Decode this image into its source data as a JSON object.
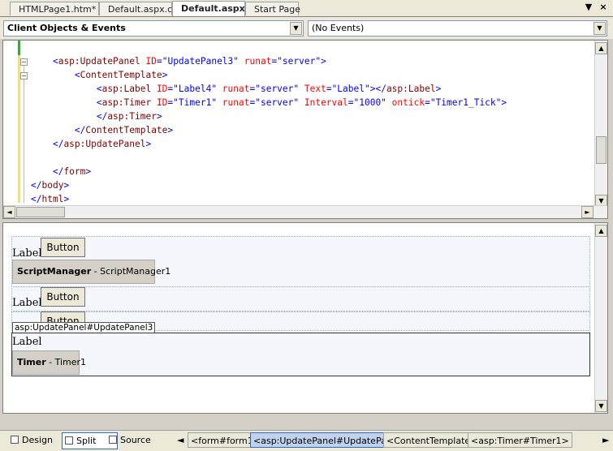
{
  "tabs": [
    {
      "label": "HTMLPage1.htm*"
    },
    {
      "label": "Default.aspx.cs"
    },
    {
      "label": "Default.aspx*"
    },
    {
      "label": "Start Page"
    }
  ],
  "tab_controls": {
    "dropdown": "▼",
    "close": "×"
  },
  "dropdowns": {
    "objects": "Client Objects & Events",
    "events": "(No Events)"
  },
  "code_lines": [
    {
      "indent": "    ",
      "tokens": [
        {
          "t": "<",
          "c": "b"
        },
        {
          "t": "asp:UpdatePanel",
          "c": "m"
        },
        {
          "t": " ID",
          "c": "r"
        },
        {
          "t": "=",
          "c": "b"
        },
        {
          "t": "\"UpdatePanel3\"",
          "c": "b"
        },
        {
          "t": " runat",
          "c": "r"
        },
        {
          "t": "=",
          "c": "b"
        },
        {
          "t": "\"server\"",
          "c": "b"
        },
        {
          "t": ">",
          "c": "b"
        }
      ]
    },
    {
      "indent": "        ",
      "tokens": [
        {
          "t": "<",
          "c": "b"
        },
        {
          "t": "ContentTemplate",
          "c": "m"
        },
        {
          "t": ">",
          "c": "b"
        }
      ]
    },
    {
      "indent": "            ",
      "tokens": [
        {
          "t": "<",
          "c": "b"
        },
        {
          "t": "asp:Label",
          "c": "m"
        },
        {
          "t": " ID",
          "c": "r"
        },
        {
          "t": "=",
          "c": "b"
        },
        {
          "t": "\"Label4\"",
          "c": "b"
        },
        {
          "t": " runat",
          "c": "r"
        },
        {
          "t": "=",
          "c": "b"
        },
        {
          "t": "\"server\"",
          "c": "b"
        },
        {
          "t": " Text",
          "c": "r"
        },
        {
          "t": "=",
          "c": "b"
        },
        {
          "t": "\"Label\"",
          "c": "b"
        },
        {
          "t": "></",
          "c": "b"
        },
        {
          "t": "asp:Label",
          "c": "m"
        },
        {
          "t": ">",
          "c": "b"
        }
      ]
    },
    {
      "indent": "            ",
      "tokens": [
        {
          "t": "<",
          "c": "b"
        },
        {
          "t": "asp:Timer",
          "c": "m"
        },
        {
          "t": " ID",
          "c": "r"
        },
        {
          "t": "=",
          "c": "b"
        },
        {
          "t": "\"Timer1\"",
          "c": "b"
        },
        {
          "t": " runat",
          "c": "r"
        },
        {
          "t": "=",
          "c": "b"
        },
        {
          "t": "\"server\"",
          "c": "b"
        },
        {
          "t": " Interval",
          "c": "r"
        },
        {
          "t": "=",
          "c": "b"
        },
        {
          "t": "\"1000\"",
          "c": "b"
        },
        {
          "t": " ontick",
          "c": "r"
        },
        {
          "t": "=",
          "c": "b"
        },
        {
          "t": "\"Timer1_Tick\"",
          "c": "b"
        },
        {
          "t": ">",
          "c": "b"
        }
      ]
    },
    {
      "indent": "            ",
      "tokens": [
        {
          "t": "</",
          "c": "b"
        },
        {
          "t": "asp:Timer",
          "c": "m"
        },
        {
          "t": ">",
          "c": "b"
        }
      ]
    },
    {
      "indent": "        ",
      "tokens": [
        {
          "t": "</",
          "c": "b"
        },
        {
          "t": "ContentTemplate",
          "c": "m"
        },
        {
          "t": ">",
          "c": "b"
        }
      ]
    },
    {
      "indent": "    ",
      "tokens": [
        {
          "t": "</",
          "c": "b"
        },
        {
          "t": "asp:UpdatePanel",
          "c": "m"
        },
        {
          "t": ">",
          "c": "b"
        }
      ]
    },
    {
      "indent": "",
      "tokens": []
    },
    {
      "indent": "    ",
      "tokens": [
        {
          "t": "</",
          "c": "b"
        },
        {
          "t": "form",
          "c": "m"
        },
        {
          "t": ">",
          "c": "b"
        }
      ]
    },
    {
      "indent": "",
      "tokens": [
        {
          "t": "</",
          "c": "b"
        },
        {
          "t": "body",
          "c": "m"
        },
        {
          "t": ">",
          "c": "b"
        }
      ]
    },
    {
      "indent": "",
      "tokens": [
        {
          "t": "</",
          "c": "b"
        },
        {
          "t": "html",
          "c": "m"
        },
        {
          "t": ">",
          "c": "b"
        }
      ]
    }
  ],
  "design": {
    "label_text": "Label",
    "button_text": "Button",
    "script_manager": {
      "type": "ScriptManager",
      "id": " - ScriptManager1"
    },
    "update_panel_tag": "asp:UpdatePanel#UpdatePanel3",
    "timer": {
      "type": "Timer",
      "id": " - Timer1"
    }
  },
  "view_buttons": [
    {
      "label": "Design"
    },
    {
      "label": "Split"
    },
    {
      "label": "Source"
    }
  ],
  "breadcrumbs": [
    {
      "label": "<form#form1>"
    },
    {
      "label": "<asp:UpdatePanel#UpdatePa...>"
    },
    {
      "label": "<ContentTemplate>"
    },
    {
      "label": "<asp:Timer#Timer1>"
    }
  ],
  "arrows": {
    "up": "▲",
    "down": "▼",
    "left": "◄",
    "right": "►"
  },
  "colors": {
    "tag": "#0000ff",
    "element": "#800000",
    "attribute": "#ff0000",
    "selection": "#316ac5"
  }
}
